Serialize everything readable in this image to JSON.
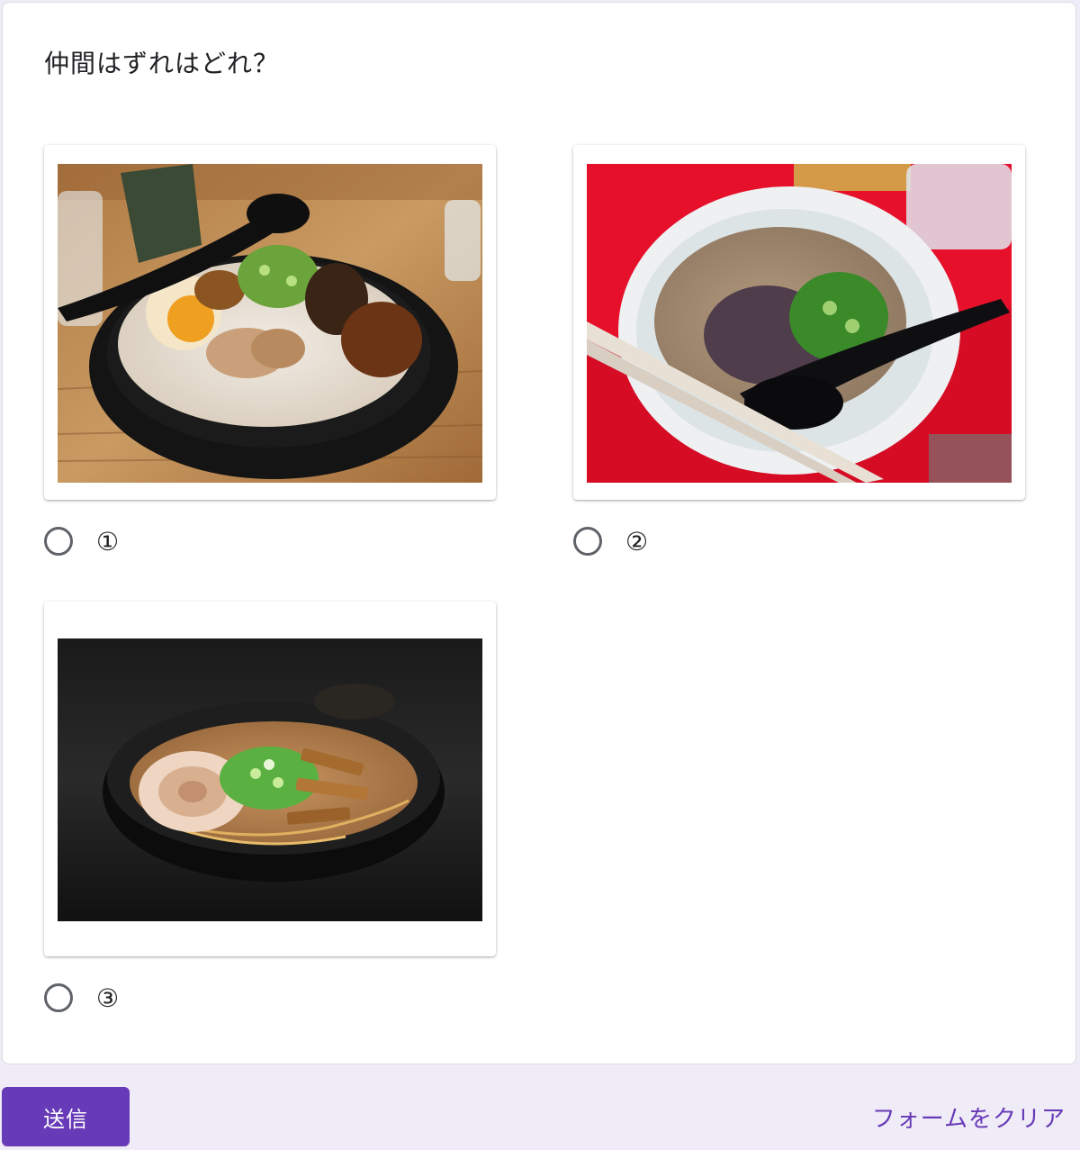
{
  "question": {
    "title": "仲間はずれはどれ？"
  },
  "options": [
    {
      "label": "①",
      "image": "tonkotsu-ramen-with-egg-photo"
    },
    {
      "label": "②",
      "image": "tonkotsu-ramen-red-table-photo"
    },
    {
      "label": "③",
      "image": "miso-ramen-black-bowl-photo"
    }
  ],
  "footer": {
    "submit_label": "送信",
    "clear_label": "フォームをクリア"
  },
  "colors": {
    "accent": "#673ab7",
    "background": "#efebf7",
    "card": "#ffffff"
  }
}
